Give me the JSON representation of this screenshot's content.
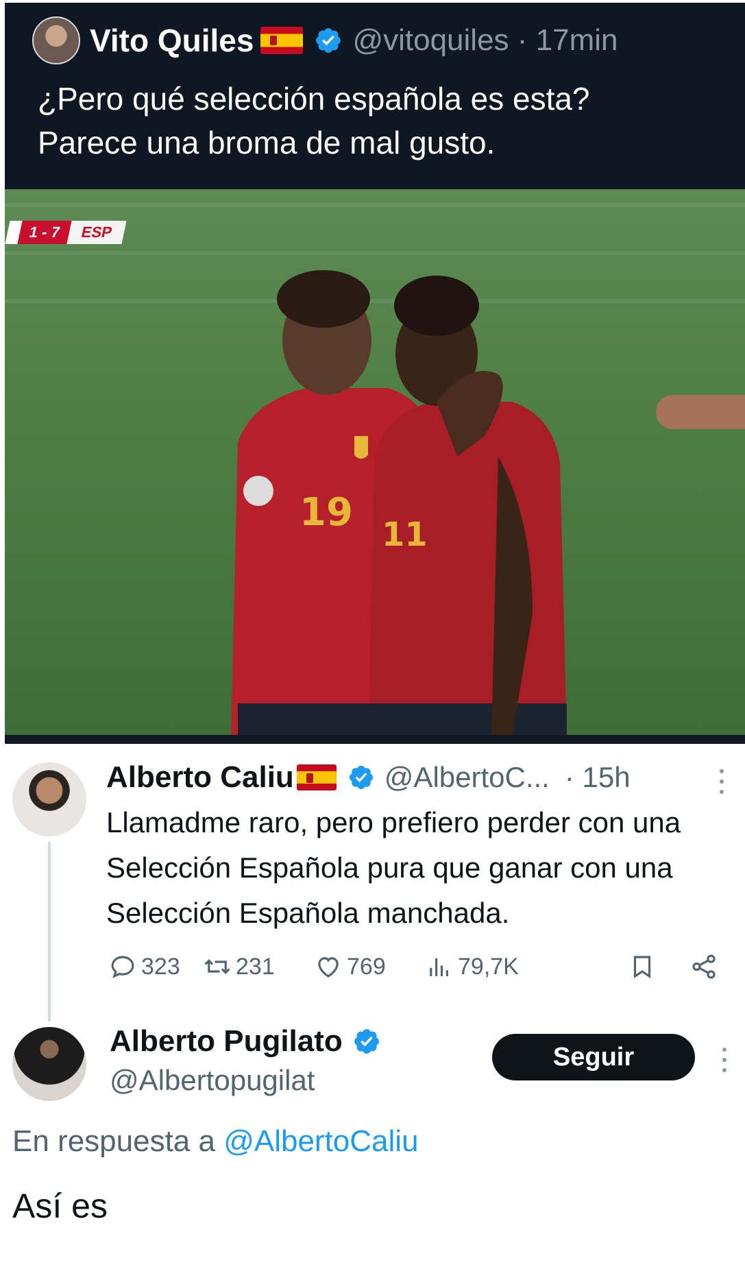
{
  "top_tweet": {
    "name": "Vito Quiles",
    "handle": "@vitoquiles",
    "separator": "·",
    "time": "17min",
    "text_line1": "¿Pero qué selección española es esta?",
    "text_line2": "Parece una broma de mal gusto.",
    "media": {
      "score": "1 - 7",
      "team": "ESP",
      "shirt_number_left": "19",
      "shirt_number_right": "11"
    }
  },
  "reply_tweet": {
    "name": "Alberto Caliu",
    "handle": "@AlbertoC...",
    "time": "· 15h",
    "text": "Llamadme raro, pero prefiero perder con una Selección Española pura que ganar con una Selección Española manchada.",
    "metrics": {
      "replies": "323",
      "reposts": "231",
      "likes": "769",
      "views": "79,7K"
    }
  },
  "main_tweet": {
    "name": "Alberto Pugilato",
    "handle": "@Albertopugilat",
    "follow_label": "Seguir",
    "reply_prefix": "En respuesta a",
    "reply_handle": "@AlbertoCaliu",
    "text": "Así es"
  },
  "colors": {
    "dark_bg": "#0f1722",
    "accent_blue": "#1d9bf0",
    "muted": "#536471",
    "spain_red": "#c60b1e",
    "spain_yellow": "#ffc400"
  },
  "icons": [
    "verified-badge-icon",
    "spain-flag-icon",
    "reply-icon",
    "repost-icon",
    "like-icon",
    "views-icon",
    "bookmark-icon",
    "share-icon",
    "more-icon"
  ]
}
